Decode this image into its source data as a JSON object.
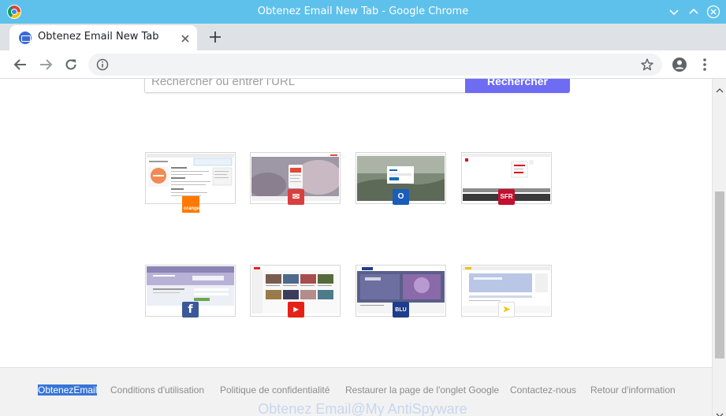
{
  "window": {
    "title": "Obtenez Email New Tab - Google Chrome",
    "titlebar_color": "#5ec1ec"
  },
  "tab": {
    "title": "Obtenez Email New Tab",
    "favicon": "envelope-icon"
  },
  "toolbar": {
    "back_icon": "arrow-left-icon",
    "forward_icon": "arrow-right-icon",
    "reload_icon": "reload-icon",
    "site_info_icon": "info-icon",
    "bookmark_icon": "star-icon",
    "account_icon": "account-circle-icon",
    "menu_icon": "three-dots-vertical-icon"
  },
  "search": {
    "placeholder": "Rechercher ou entrer l'URL",
    "button_label": "Rechercher",
    "button_color": "#6e6cf2"
  },
  "tiles": [
    {
      "site": "Orange",
      "badge_text": "orange",
      "badge_color": "#ff7900"
    },
    {
      "site": "Gmail",
      "badge_text": "✉",
      "badge_color": "#d93f3f"
    },
    {
      "site": "Outlook",
      "badge_text": "O",
      "badge_color": "#1a5dbb"
    },
    {
      "site": "SFR",
      "badge_text": "SFR",
      "badge_color": "#c3102f"
    },
    {
      "site": "Facebook",
      "badge_text": "f",
      "badge_color": "#3b5998"
    },
    {
      "site": "YouTube",
      "badge_text": "▶",
      "badge_color": "#e62117"
    },
    {
      "site": "Bluewin",
      "badge_text": "BLU",
      "badge_color": "#1f3d8a"
    },
    {
      "site": "La Poste",
      "badge_text": "➤",
      "badge_color": "#f2c300"
    }
  ],
  "footer": {
    "links": [
      "ObtenezEmail",
      "Conditions d'utilisation",
      "Politique de confidentialité",
      "Restaurer la page de l'onglet Google",
      "Contactez-nous",
      "Retour d'information"
    ],
    "selected_link_color": "#3875d7",
    "watermark": "Obtenez Email@My AntiSpyware"
  }
}
